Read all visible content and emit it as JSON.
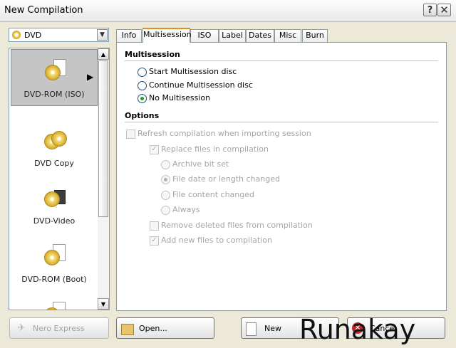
{
  "window": {
    "title": "New Compilation",
    "help_label": "?",
    "close_label": "✕"
  },
  "disc_type": {
    "selected": "DVD"
  },
  "compilation_types": [
    {
      "label": "DVD-ROM (ISO)",
      "selected": true
    },
    {
      "label": "DVD Copy",
      "selected": false
    },
    {
      "label": "DVD-Video",
      "selected": false
    },
    {
      "label": "DVD-ROM (Boot)",
      "selected": false
    }
  ],
  "tabs": [
    {
      "label": "Info"
    },
    {
      "label": "Multisession"
    },
    {
      "label": "ISO"
    },
    {
      "label": "Label"
    },
    {
      "label": "Dates"
    },
    {
      "label": "Misc"
    },
    {
      "label": "Burn"
    }
  ],
  "active_tab": "Multisession",
  "multisession": {
    "heading": "Multisession",
    "options": [
      {
        "label": "Start Multisession disc",
        "selected": false
      },
      {
        "label": "Continue Multisession disc",
        "selected": false
      },
      {
        "label": "No Multisession",
        "selected": true
      }
    ]
  },
  "options": {
    "heading": "Options",
    "refresh": {
      "label": "Refresh compilation when importing session",
      "checked": false
    },
    "replace": {
      "label": "Replace files in compilation",
      "checked": true
    },
    "replace_modes": [
      {
        "label": "Archive bit set",
        "selected": false
      },
      {
        "label": "File date or length changed",
        "selected": true
      },
      {
        "label": "File content changed",
        "selected": false
      },
      {
        "label": "Always",
        "selected": false
      }
    ],
    "remove": {
      "label": "Remove deleted files from compilation",
      "checked": false
    },
    "add": {
      "label": "Add new files to compilation",
      "checked": true
    }
  },
  "buttons": {
    "nero_express": "Nero Express",
    "open": "Open...",
    "new": "New",
    "cancel": "Cancel"
  },
  "watermark": "Runakay",
  "colors": {
    "active_tab_accent": "#e68b2c",
    "selected_radio": "#21a121",
    "cancel_icon": "#c0282d"
  }
}
